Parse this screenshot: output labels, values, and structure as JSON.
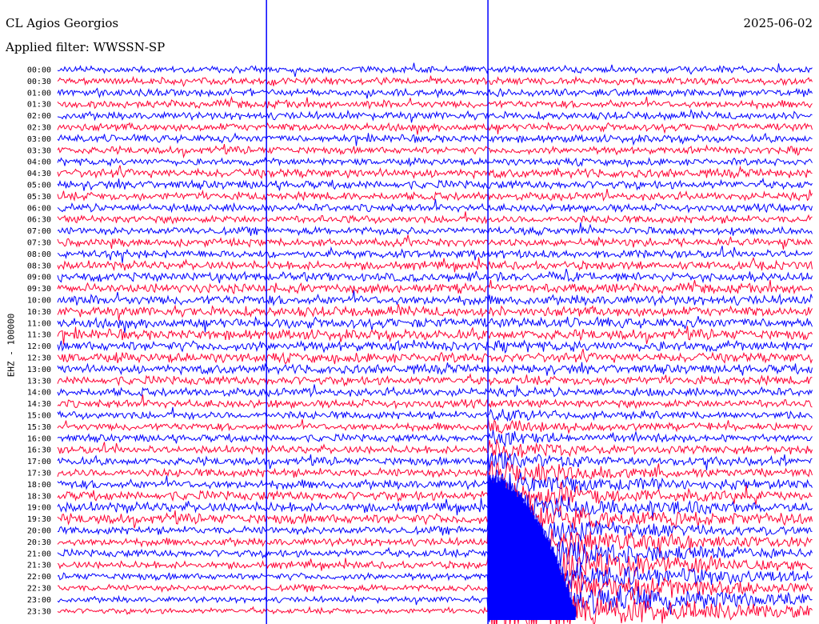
{
  "header": {
    "station": "CL Agios Georgios",
    "date": "2025-06-02",
    "filter": "Applied filter: WWSSN-SP"
  },
  "chart_data": {
    "type": "line",
    "ylabel": "EHZ - 100000",
    "row_labels": [
      "00:00",
      "00:30",
      "01:00",
      "01:30",
      "02:00",
      "02:30",
      "03:00",
      "03:30",
      "04:00",
      "04:30",
      "05:00",
      "05:30",
      "06:00",
      "06:30",
      "07:00",
      "07:30",
      "08:00",
      "08:30",
      "09:00",
      "09:30",
      "10:00",
      "10:30",
      "11:00",
      "11:30",
      "12:00",
      "12:30",
      "13:00",
      "13:30",
      "14:00",
      "14:30",
      "15:00",
      "15:30",
      "16:00",
      "16:30",
      "17:00",
      "17:30",
      "18:00",
      "18:30",
      "19:00",
      "19:30",
      "20:00",
      "20:30",
      "21:00",
      "21:30",
      "22:00",
      "22:30",
      "23:00",
      "23:30"
    ],
    "row_minutes": 30,
    "series_colors": [
      "#0000ff",
      "#ff0033"
    ],
    "events": [
      {
        "row": 0,
        "minute": 8.3,
        "type": "spike"
      },
      {
        "row": 0,
        "minute": 17.1,
        "type": "earthquake"
      }
    ]
  }
}
